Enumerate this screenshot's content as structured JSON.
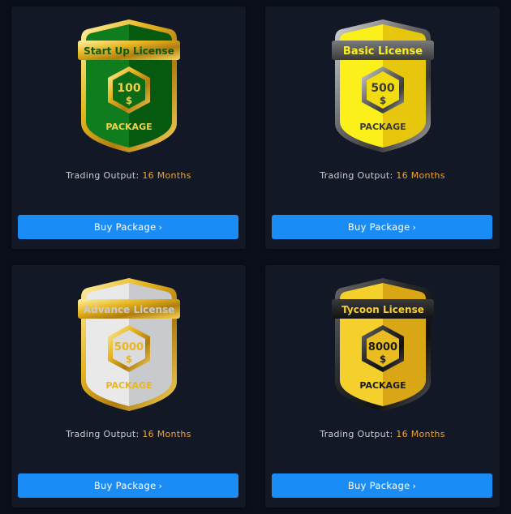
{
  "colors": {
    "page_bg": "#0b0f1b",
    "card_bg": "#131826",
    "button": "#1a8cf5",
    "accent_value": "#f0a42b",
    "gold": "#e7b622"
  },
  "packages": [
    {
      "title": "Start Up License",
      "amount": "100",
      "currency": "$",
      "package_word": "PACKAGE",
      "output_label": "Trading Output:",
      "output_value": "16 Months",
      "button_label": "Buy Package",
      "button_icon": "chevron-right-icon",
      "theme": "green"
    },
    {
      "title": "Basic License",
      "amount": "500",
      "currency": "$",
      "package_word": "PACKAGE",
      "output_label": "Trading Output:",
      "output_value": "16 Months",
      "button_label": "Buy Package",
      "button_icon": "chevron-right-icon",
      "theme": "yellow"
    },
    {
      "title": "Advance License",
      "amount": "5000",
      "currency": "$",
      "package_word": "PACKAGE",
      "output_label": "Trading Output:",
      "output_value": "16 Months",
      "button_label": "Buy Package",
      "button_icon": "chevron-right-icon",
      "theme": "silver"
    },
    {
      "title": "Tycoon License",
      "amount": "8000",
      "currency": "$",
      "package_word": "PACKAGE",
      "output_label": "Trading Output:",
      "output_value": "16 Months",
      "button_label": "Buy Package",
      "button_icon": "chevron-right-icon",
      "theme": "black-gold"
    }
  ]
}
